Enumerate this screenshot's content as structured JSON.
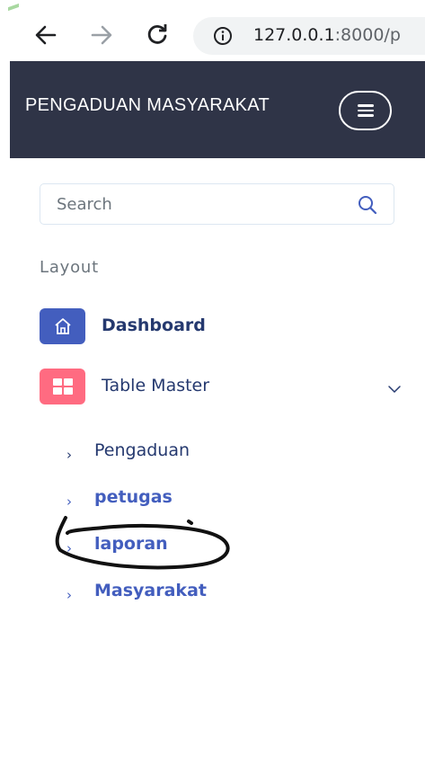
{
  "browser": {
    "url_host": "127.0.0.1",
    "url_path": ":8000/p",
    "icons": {
      "back": "arrow-left-icon",
      "forward": "arrow-right-icon",
      "reload": "reload-icon",
      "info": "info-icon"
    }
  },
  "header": {
    "title": "PENGADUAN MASYARAKAT",
    "background": "#2f3447",
    "menu_icon": "hamburger-icon"
  },
  "sidebar": {
    "search": {
      "placeholder": "Search",
      "value": "",
      "icon": "search-icon"
    },
    "section_title": "Layout",
    "items": [
      {
        "label": "Dashboard",
        "icon": "home-icon",
        "icon_color": "#435ebe",
        "active": true
      },
      {
        "label": "Table Master",
        "icon": "grid-icon",
        "icon_color": "#ff6b81",
        "expanded": true,
        "chevron": "chevron-down-icon"
      }
    ],
    "submenu": [
      {
        "label": "Pengaduan",
        "state": "default"
      },
      {
        "label": "petugas",
        "state": "link"
      },
      {
        "label": "laporan",
        "state": "link",
        "annotated": true
      },
      {
        "label": "Masyarakat",
        "state": "link"
      }
    ],
    "colors": {
      "text": "#25396f",
      "link": "#435ebe",
      "muted": "#6c757d"
    }
  }
}
